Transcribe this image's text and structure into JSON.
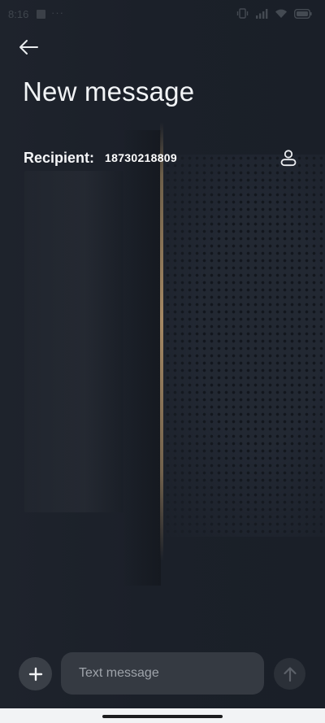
{
  "status_bar": {
    "time": "8:16",
    "overflow": "···"
  },
  "header": {
    "back_icon": "arrow-left-icon",
    "title": "New message"
  },
  "recipient": {
    "label": "Recipient:",
    "value": "18730218809",
    "contact_icon": "person-icon"
  },
  "compose": {
    "attach_icon": "plus-icon",
    "placeholder": "Text message",
    "value": "",
    "send_icon": "arrow-up-icon"
  },
  "colors": {
    "background": "#1b2028",
    "text": "#f2f4f6",
    "input_bg": "#353a42",
    "button_bg": "#3a3f47",
    "accent_stripe": "#be9b6e"
  }
}
